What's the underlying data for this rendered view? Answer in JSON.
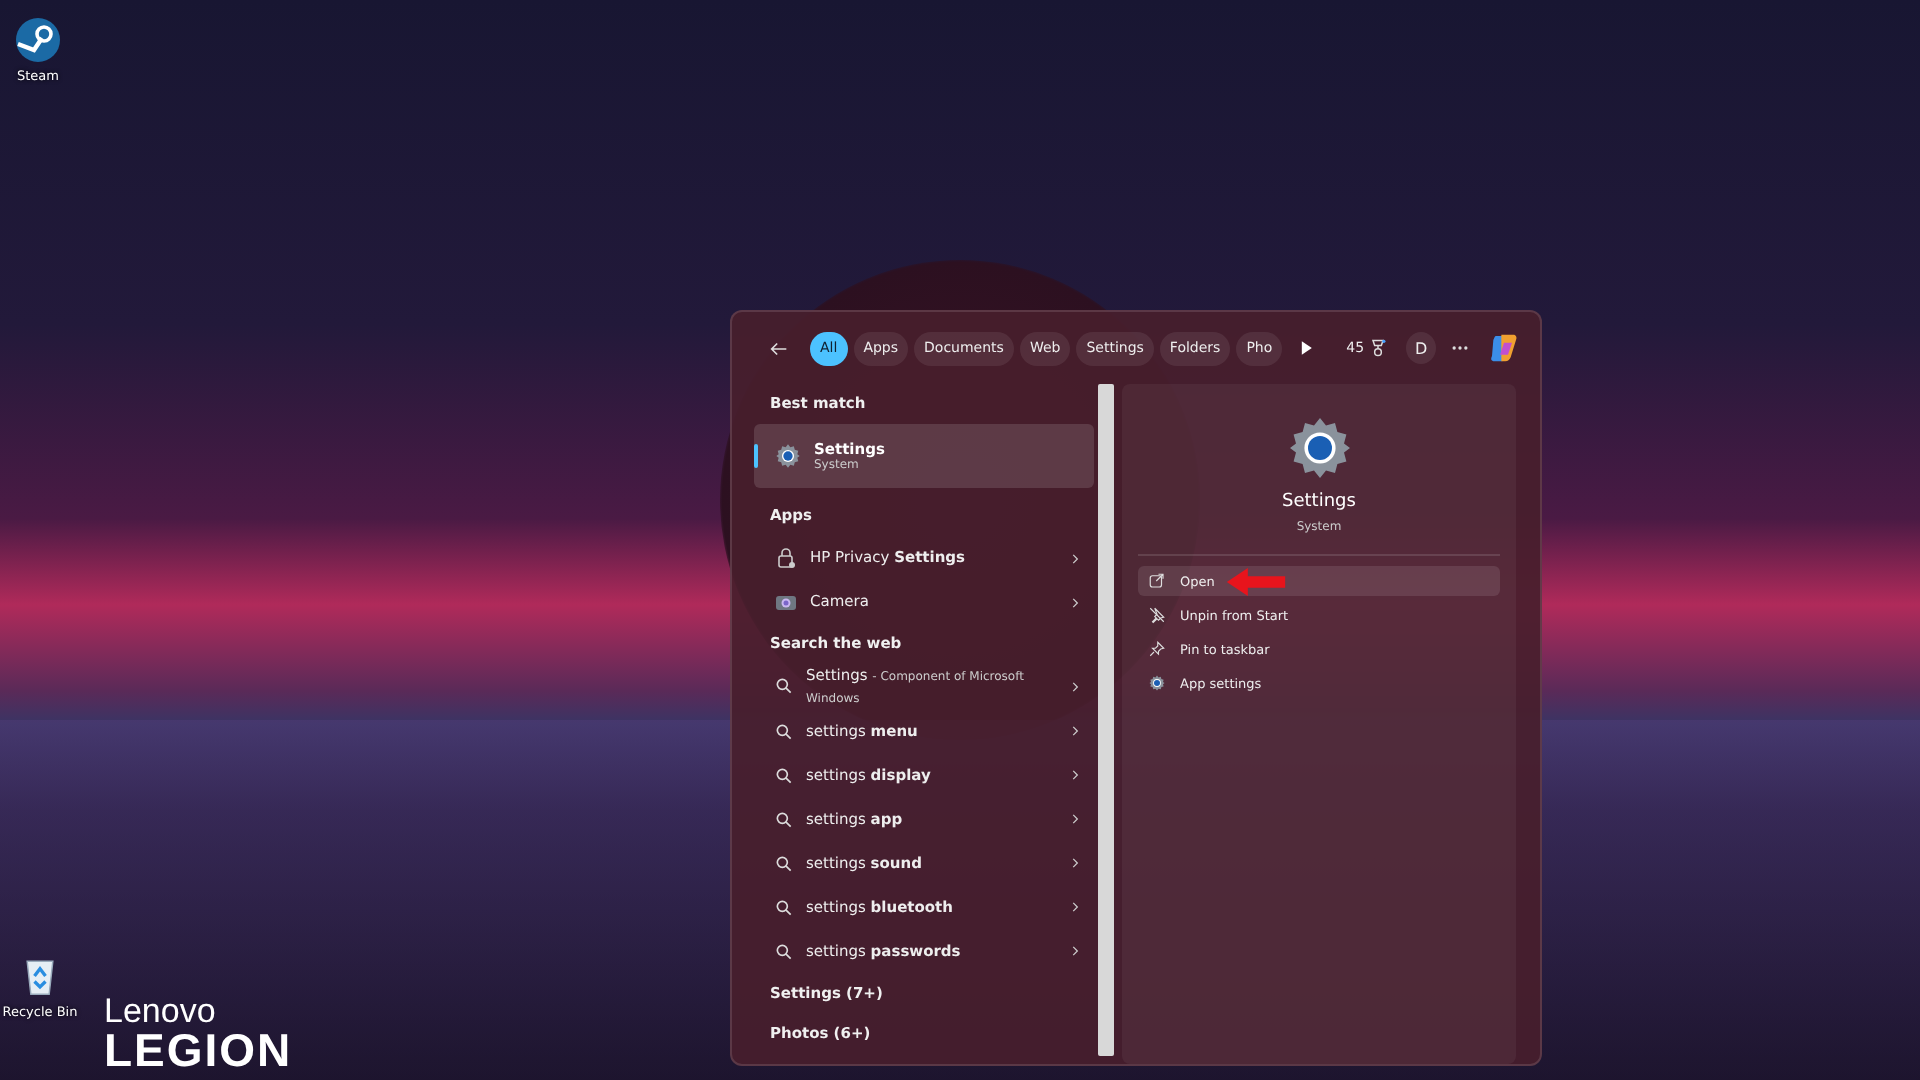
{
  "desktop_icons": [
    {
      "kind": "steam",
      "label": "Steam"
    },
    {
      "kind": "recycle",
      "label": "Recycle Bin"
    }
  ],
  "wallpaper_brand": {
    "line_1": "Lenovo",
    "line_2": "LEGION"
  },
  "search": {
    "filters": [
      {
        "label": "All",
        "selected": true
      },
      {
        "label": "Apps",
        "selected": false
      },
      {
        "label": "Documents",
        "selected": false
      },
      {
        "label": "Web",
        "selected": false
      },
      {
        "label": "Settings",
        "selected": false
      },
      {
        "label": "Folders",
        "selected": false
      },
      {
        "label": "Pho",
        "selected": false
      }
    ],
    "points": "45",
    "account": "D",
    "sections": [
      {
        "heading": "Best match",
        "items": [
          {
            "kind": "best",
            "title": "Settings",
            "subtitle": "System",
            "selected": true
          }
        ]
      },
      {
        "heading": "Apps",
        "items": [
          {
            "kind": "app",
            "title": "HP Privacy **Settings**",
            "selected": false
          },
          {
            "kind": "app",
            "title": "Camera",
            "selected": false
          }
        ]
      },
      {
        "heading": "Search the web",
        "items": [
          {
            "kind": "web",
            "title": "Settings",
            "subtitle": "- Component of Microsoft Windows",
            "selected": false
          },
          {
            "kind": "web",
            "title": "settings **menu**",
            "selected": false
          },
          {
            "kind": "web",
            "title": "settings **display**",
            "selected": false
          },
          {
            "kind": "web",
            "title": "settings **app**",
            "selected": false
          },
          {
            "kind": "web",
            "title": "settings **sound**",
            "selected": false
          },
          {
            "kind": "web",
            "title": "settings **bluetooth**",
            "selected": false
          },
          {
            "kind": "web",
            "title": "settings **passwords**",
            "selected": false
          }
        ]
      },
      {
        "heading": "Settings (7+)"
      },
      {
        "heading": "Photos (6+)"
      }
    ],
    "preview": {
      "title": "Settings",
      "subtitle": "System",
      "actions": [
        {
          "label": "Open",
          "selected": true,
          "pointed_at": true
        },
        {
          "label": "Unpin from Start",
          "selected": false,
          "pointed_at": false
        },
        {
          "label": "Pin to taskbar",
          "selected": false,
          "pointed_at": false
        },
        {
          "label": "App settings",
          "selected": false,
          "pointed_at": false
        }
      ]
    }
  }
}
